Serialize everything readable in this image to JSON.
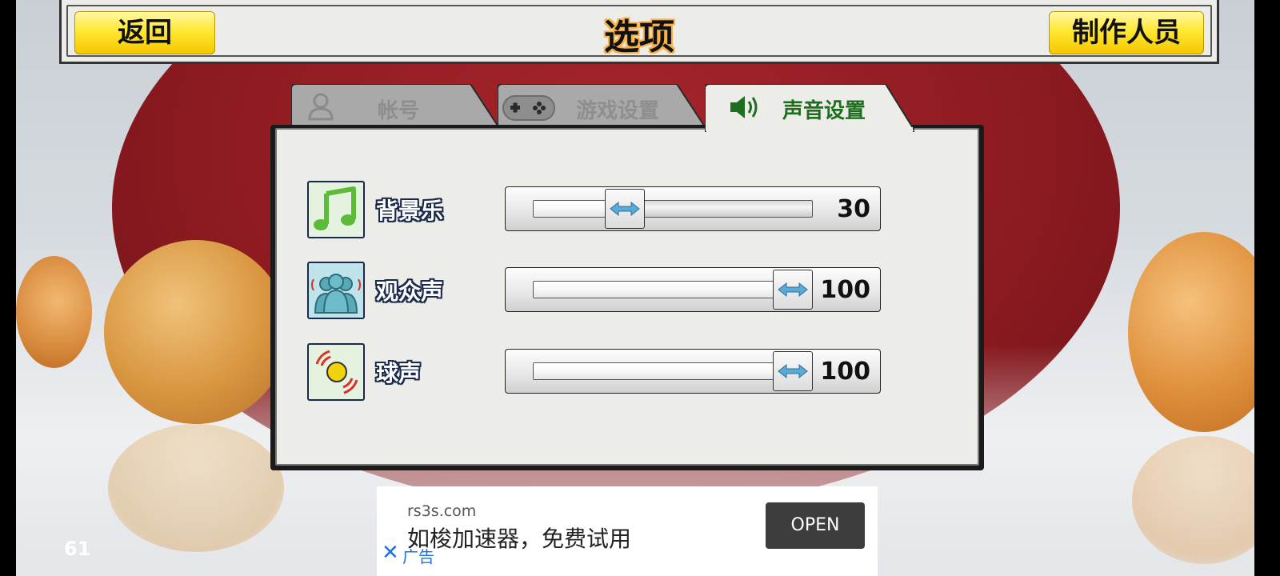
{
  "header": {
    "back_label": "返回",
    "title": "选项",
    "credits_label": "制作人员"
  },
  "tabs": [
    {
      "label": "帐号",
      "icon": "user-icon",
      "active": false
    },
    {
      "label": "游戏设置",
      "icon": "gamepad-icon",
      "active": false
    },
    {
      "label": "声音设置",
      "icon": "speaker-icon",
      "active": true
    }
  ],
  "sound_settings": [
    {
      "label": "背景乐",
      "icon": "music-note-icon",
      "value": 30,
      "max": 100
    },
    {
      "label": "观众声",
      "icon": "audience-icon",
      "value": 100,
      "max": 100
    },
    {
      "label": "球声",
      "icon": "ball-sound-icon",
      "value": 100,
      "max": 100
    }
  ],
  "ad": {
    "domain": "rs3s.com",
    "text": "如梭加速器，免费试用",
    "open_label": "OPEN",
    "tag": "广告"
  },
  "fps_counter": "61",
  "colors": {
    "button_yellow": "#ffe733",
    "active_tab_text": "#1f6e1f",
    "inactive_tab_text": "#8e8e8e",
    "paddle_red": "#8e1b21"
  }
}
